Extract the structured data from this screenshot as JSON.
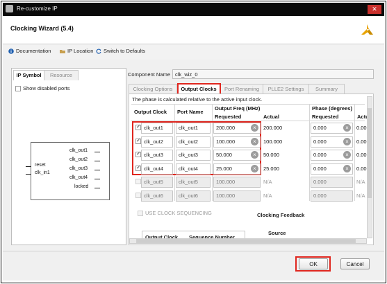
{
  "window": {
    "title": "Re-customize IP",
    "close_glyph": "✕"
  },
  "wizard": {
    "title": "Clocking Wizard (5.4)",
    "logo": "xilinx-logo-icon"
  },
  "toolbar": {
    "documentation": "Documentation",
    "ip_location": "IP Location",
    "switch_defaults": "Switch to Defaults"
  },
  "left": {
    "tabs": [
      "IP Symbol",
      "Resource"
    ],
    "show_disabled_label": "Show disabled ports",
    "symbol": {
      "inputs": [
        "reset",
        "clk_in1"
      ],
      "outputs": [
        "clk_out1",
        "clk_out2",
        "clk_out3",
        "clk_out4",
        "locked"
      ]
    }
  },
  "right": {
    "component_name_label": "Component Name",
    "component_name_value": "clk_wiz_0",
    "tabs": [
      "Clocking Options",
      "Output Clocks",
      "Port Renaming",
      "PLLE2 Settings",
      "Summary"
    ],
    "active_tab": "Output Clocks",
    "note": "The phase is calculated relative to the active input clock.",
    "table": {
      "headers": {
        "output_clock": "Output Clock",
        "port_name": "Port Name",
        "output_freq": "Output Freq (MHz)",
        "requested": "Requested",
        "actual": "Actual",
        "phase": "Phase (degrees)",
        "phase_requested": "Requested",
        "phase_actual": "Actu"
      },
      "rows": [
        {
          "checked": true,
          "clock": "clk_out1",
          "port": "clk_out1",
          "req": "200.000",
          "actual": "200.000",
          "phase": "0.000",
          "phase_actual": "0.00"
        },
        {
          "checked": true,
          "clock": "clk_out2",
          "port": "clk_out2",
          "req": "100.000",
          "actual": "100.000",
          "phase": "0.000",
          "phase_actual": "0.00"
        },
        {
          "checked": true,
          "clock": "clk_out3",
          "port": "clk_out3",
          "req": "50.000",
          "actual": "50.000",
          "phase": "0.000",
          "phase_actual": "0.00"
        },
        {
          "checked": true,
          "clock": "clk_out4",
          "port": "clk_out4",
          "req": "25.000",
          "actual": "25.000",
          "phase": "0.000",
          "phase_actual": "0.00"
        },
        {
          "checked": false,
          "clock": "clk_out5",
          "port": "clk_out5",
          "req": "100.000",
          "actual": "N/A",
          "phase": "0.000",
          "phase_actual": "N/A"
        },
        {
          "checked": false,
          "clock": "clk_out6",
          "port": "clk_out6",
          "req": "100.000",
          "actual": "N/A",
          "phase": "0.000",
          "phase_actual": "N/A"
        }
      ]
    },
    "use_clock_sequencing": "USE CLOCK SEQUENCING",
    "clocking_feedback": "Clocking Feedback",
    "source": "Source",
    "subtable_headers": [
      "Output Clock",
      "Sequence Number"
    ]
  },
  "footer": {
    "ok": "OK",
    "cancel": "Cancel"
  },
  "colors": {
    "highlight": "#e0261e",
    "titlebar": "#0a0a0a",
    "info_icon": "#2060b0"
  }
}
